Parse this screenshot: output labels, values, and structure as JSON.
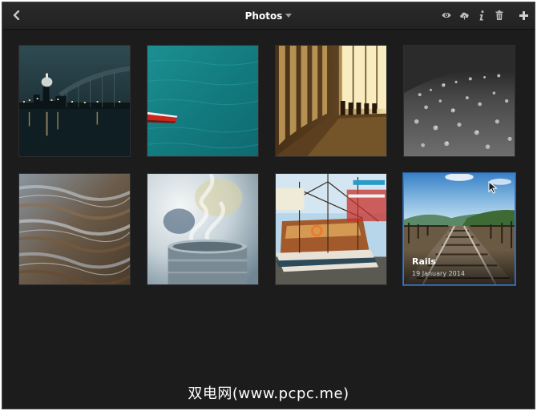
{
  "header": {
    "title": "Photos",
    "back_icon": "chevron-left-icon",
    "title_dropdown_icon": "caret-down-icon",
    "tools": [
      {
        "name": "eye-icon"
      },
      {
        "name": "cloud-upload-icon"
      },
      {
        "name": "info-icon"
      },
      {
        "name": "trash-icon"
      },
      {
        "name": "plus-icon"
      }
    ]
  },
  "photos": [
    {
      "subject": "city-night-skyline"
    },
    {
      "subject": "boat-on-turquoise-water"
    },
    {
      "subject": "sepia-interior-columns"
    },
    {
      "subject": "wet-surface-droplets"
    },
    {
      "subject": "blurred-water-texture"
    },
    {
      "subject": "steaming-cup"
    },
    {
      "subject": "sailboats-harbor"
    },
    {
      "subject": "railway-tracks",
      "selected": true,
      "title": "Rails",
      "date": "19 January 2014"
    }
  ],
  "watermark": "双电网(www.pcpc.me)",
  "colors": {
    "background": "#1c1c1c",
    "topbar": "#242424",
    "selection": "#3c78c8",
    "icon": "#bdbdbd"
  }
}
